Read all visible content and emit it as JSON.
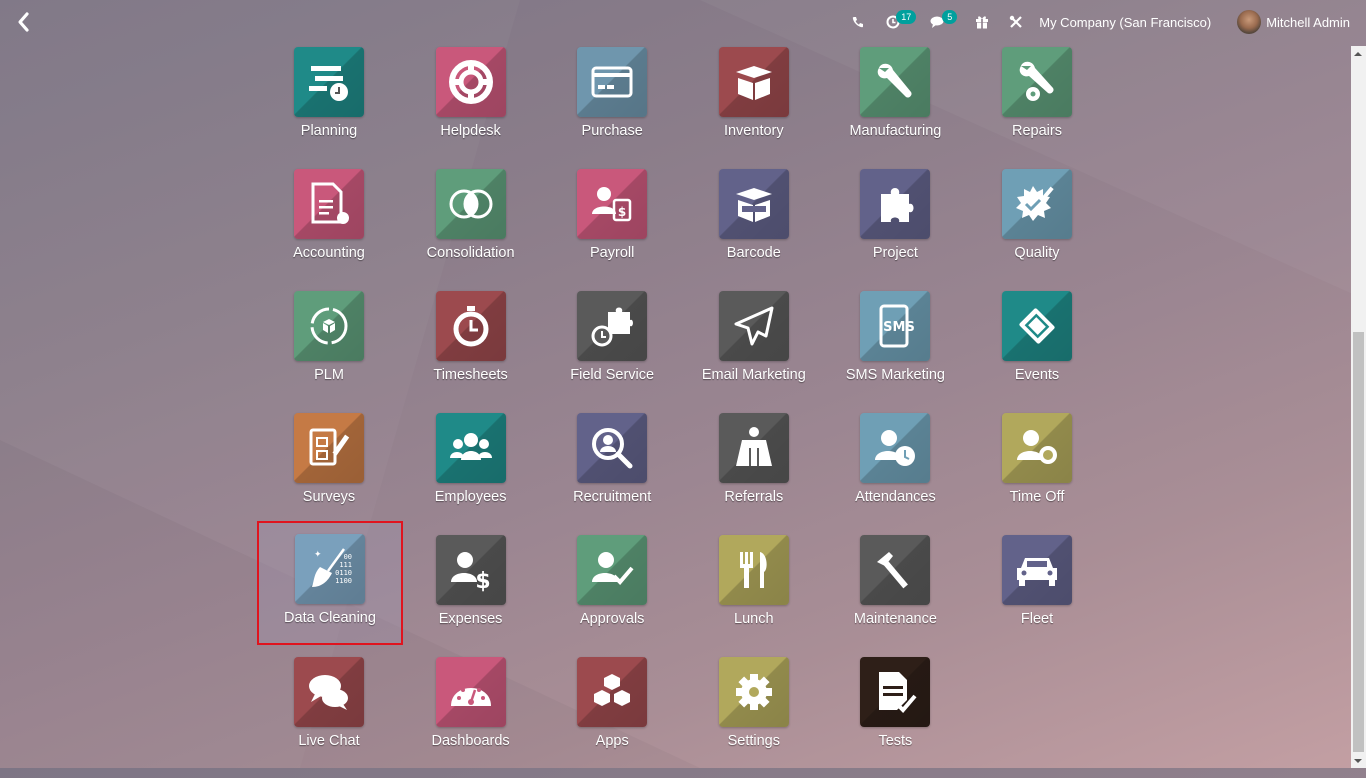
{
  "topbar": {
    "back_label": "Back",
    "systray": {
      "activity_count": "17",
      "messages_count": "5",
      "company": "My Company (San Francisco)",
      "user_name": "Mitchell Admin"
    }
  },
  "apps": [
    {
      "name": "Planning",
      "icon": "planning-icon",
      "color": "#1f8a88"
    },
    {
      "name": "Helpdesk",
      "icon": "lifebuoy-icon",
      "color": "#c9587b"
    },
    {
      "name": "Purchase",
      "icon": "credit-card-icon",
      "color": "#6f96ad"
    },
    {
      "name": "Inventory",
      "icon": "open-box-icon",
      "color": "#9c4a4e"
    },
    {
      "name": "Manufacturing",
      "icon": "wrench-icon",
      "color": "#5f9d7b"
    },
    {
      "name": "Repairs",
      "icon": "wrench-gear-icon",
      "color": "#5f9d7b"
    },
    {
      "name": "Accounting",
      "icon": "document-gear-icon",
      "color": "#c9587b"
    },
    {
      "name": "Consolidation",
      "icon": "overlapping-circles-icon",
      "color": "#5f9d7b"
    },
    {
      "name": "Payroll",
      "icon": "user-calendar-dollar-icon",
      "color": "#c9587b"
    },
    {
      "name": "Barcode",
      "icon": "box-barcode-icon",
      "color": "#62628a"
    },
    {
      "name": "Project",
      "icon": "puzzle-piece-icon",
      "color": "#62628a"
    },
    {
      "name": "Quality",
      "icon": "seal-pencil-icon",
      "color": "#6f9fb5"
    },
    {
      "name": "PLM",
      "icon": "cycle-box-icon",
      "color": "#5f9d7b"
    },
    {
      "name": "Timesheets",
      "icon": "stopwatch-icon",
      "color": "#9c4a4e"
    },
    {
      "name": "Field Service",
      "icon": "puzzle-stopwatch-icon",
      "color": "#5a5a5a"
    },
    {
      "name": "Email Marketing",
      "icon": "paper-plane-icon",
      "color": "#5a5a5a"
    },
    {
      "name": "SMS Marketing",
      "icon": "sms-phone-icon",
      "color": "#6f9fb5"
    },
    {
      "name": "Events",
      "icon": "ticket-icon",
      "color": "#1f8a88"
    },
    {
      "name": "Surveys",
      "icon": "clipboard-pencil-icon",
      "color": "#c57a45"
    },
    {
      "name": "Employees",
      "icon": "users-icon",
      "color": "#1f8a88"
    },
    {
      "name": "Recruitment",
      "icon": "magnifier-user-icon",
      "color": "#62628a"
    },
    {
      "name": "Referrals",
      "icon": "superhero-icon",
      "color": "#5a5a5a"
    },
    {
      "name": "Attendances",
      "icon": "user-clock-icon",
      "color": "#6f9fb5"
    },
    {
      "name": "Time Off",
      "icon": "user-sun-icon",
      "color": "#b1a85c"
    },
    {
      "name": "Data Cleaning",
      "icon": "broom-binary-icon",
      "color": "#7aa0bc",
      "highlighted": true
    },
    {
      "name": "Expenses",
      "icon": "user-dollar-icon",
      "color": "#5a5a5a"
    },
    {
      "name": "Approvals",
      "icon": "user-check-icon",
      "color": "#5f9d7b"
    },
    {
      "name": "Lunch",
      "icon": "fork-knife-icon",
      "color": "#b1a85c"
    },
    {
      "name": "Maintenance",
      "icon": "hammer-icon",
      "color": "#5a5a5a"
    },
    {
      "name": "Fleet",
      "icon": "car-icon",
      "color": "#62628a"
    },
    {
      "name": "Live Chat",
      "icon": "chat-bubbles-icon",
      "color": "#9c4a4e"
    },
    {
      "name": "Dashboards",
      "icon": "gauge-icon",
      "color": "#c9587b"
    },
    {
      "name": "Apps",
      "icon": "cubes-icon",
      "color": "#9c4a4e"
    },
    {
      "name": "Settings",
      "icon": "gear-icon",
      "color": "#b1a85c"
    },
    {
      "name": "Tests",
      "icon": "document-check-icon",
      "color": "#2e1f18"
    }
  ]
}
